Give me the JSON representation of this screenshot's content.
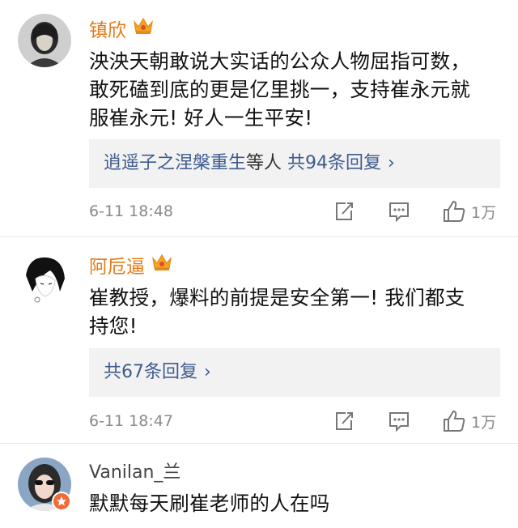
{
  "comments": [
    {
      "username": "镇欣",
      "content_lines": [
        "泱泱天朝敢说大实话的公众人物屈指可数，",
        "敢死磕到底的更是亿里挑一，支持崔永元就",
        "服崔永元! 好人一生平安!"
      ],
      "reply": {
        "names": "逍遥子之涅槃重生",
        "mid": "等人",
        "count_text": "共94条回复",
        "chevron": "›"
      },
      "time": "6-11 18:48",
      "likes": "1万",
      "icons": {
        "share": "share-icon",
        "comment": "comment-icon",
        "like": "thumbs-up-icon"
      }
    },
    {
      "username": "阿卮逼",
      "content_lines": [
        "崔教授，爆料的前提是安全第一! 我们都支",
        "持您!"
      ],
      "reply": {
        "count_text": "共67条回复",
        "chevron": "›"
      },
      "time": "6-11 18:47",
      "likes": "1万"
    },
    {
      "username": "Vanilan_兰",
      "content_lines": [
        "默默每天刷崔老师的人在吗"
      ]
    }
  ],
  "colors": {
    "vip_name": "#e67c19",
    "link": "#3f5c8f",
    "meta": "#8a8a8a",
    "reply_bg": "#f2f2f2"
  }
}
